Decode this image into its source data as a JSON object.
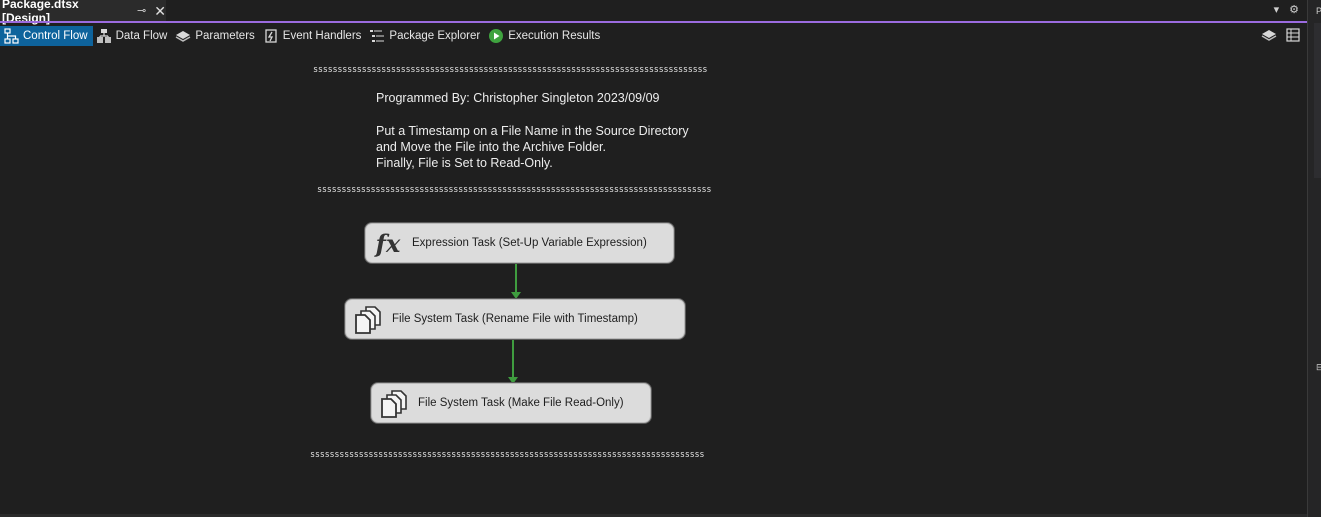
{
  "document_tab": {
    "title": "Package.dtsx [Design]",
    "pin_glyph": "⊸",
    "close_glyph": "✕"
  },
  "designer_tabs": [
    {
      "label": "Control Flow",
      "icon": "control-flow-icon",
      "active": true
    },
    {
      "label": "Data Flow",
      "icon": "data-flow-icon",
      "active": false
    },
    {
      "label": "Parameters",
      "icon": "parameters-icon",
      "active": false
    },
    {
      "label": "Event Handlers",
      "icon": "event-handlers-icon",
      "active": false
    },
    {
      "label": "Package Explorer",
      "icon": "package-explorer-icon",
      "active": false
    },
    {
      "label": "Execution Results",
      "icon": "execution-results-icon",
      "active": false
    }
  ],
  "canvas": {
    "separator_top": "sssssssssssssssssssssssssssssssssssssssssssssssssssssssssssssssssssssssssssssssss",
    "note_line1": "Programmed By: Christopher Singleton 2023/09/09",
    "note_line2": "Put a Timestamp on a File Name in the Source Directory",
    "note_line3": "and Move the File into the Archive Folder.",
    "note_line4": "Finally, File is Set to Read-Only.",
    "separator_mid": "sssssssssssssssssssssssssssssssssssssssssssssssssssssssssssssssssssssssssssssssss",
    "separator_bottom": "sssssssssssssssssssssssssssssssssssssssssssssssssssssssssssssssssssssssssssssssss",
    "tasks": [
      {
        "label": "Expression Task (Set-Up Variable Expression)",
        "icon": "fx-icon",
        "icon_text": "fx"
      },
      {
        "label": "File System Task (Rename File with Timestamp)",
        "icon": "file-system-icon"
      },
      {
        "label": "File System Task (Make File Read-Only)",
        "icon": "file-system-icon"
      }
    ],
    "connector_color": "#3f9d3f"
  },
  "colors": {
    "background": "#1f1f1f",
    "active_tab": "#0e639c",
    "accent_underline": "#9b6bdf",
    "task_fill": "#dcdcdc"
  }
}
